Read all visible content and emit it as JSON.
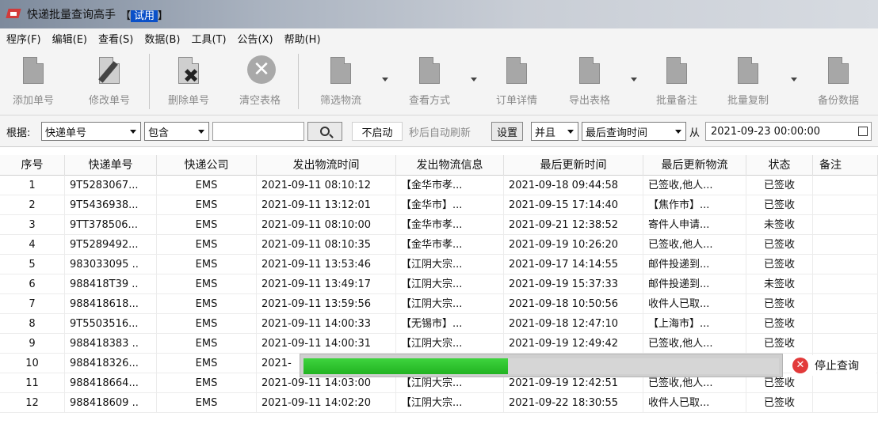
{
  "window": {
    "title": "快递批量查询高手",
    "badge": "试用"
  },
  "menu": [
    "程序(F)",
    "编辑(E)",
    "查看(S)",
    "数据(B)",
    "工具(T)",
    "公告(X)",
    "帮助(H)"
  ],
  "toolbar": {
    "add": "添加单号",
    "edit": "修改单号",
    "delete": "删除单号",
    "clear": "清空表格",
    "filter": "筛选物流",
    "view": "查看方式",
    "detail": "订单详情",
    "export": "导出表格",
    "batch_note": "批量备注",
    "batch_copy": "批量复制",
    "backup": "备份数据"
  },
  "filter": {
    "label": "根据:",
    "field": "快递单号",
    "mode": "包含",
    "query": "",
    "auto_state": "不启动",
    "auto_text": "秒后自动刷新",
    "settings": "设置",
    "logic": "并且",
    "time_field": "最后查询时间",
    "from_label": "从",
    "from_value": "2021-09-23 00:00:00"
  },
  "columns": [
    "序号",
    "快递单号",
    "快递公司",
    "发出物流时间",
    "发出物流信息",
    "最后更新时间",
    "最后更新物流",
    "状态",
    "备注"
  ],
  "rows": [
    [
      "1",
      "9T5283067...",
      "EMS",
      "2021-09-11 08:10:12",
      "【金华市孝...",
      "2021-09-18 09:44:58",
      "已签收,他人...",
      "已签收",
      ""
    ],
    [
      "2",
      "9T5436938...",
      "EMS",
      "2021-09-11 13:12:01",
      "【金华市】...",
      "2021-09-15 17:14:40",
      "【焦作市】...",
      "已签收",
      ""
    ],
    [
      "3",
      "9TT378506...",
      "EMS",
      "2021-09-11 08:10:00",
      "【金华市孝...",
      "2021-09-21 12:38:52",
      "寄件人申请...",
      "未签收",
      ""
    ],
    [
      "4",
      "9T5289492...",
      "EMS",
      "2021-09-11 08:10:35",
      "【金华市孝...",
      "2021-09-19 10:26:20",
      "已签收,他人...",
      "已签收",
      ""
    ],
    [
      "5",
      "983033095 ..",
      "EMS",
      "2021-09-11 13:53:46",
      "【江阴大宗...",
      "2021-09-17 14:14:55",
      "邮件投递到...",
      "已签收",
      ""
    ],
    [
      "6",
      "988418T39 ..",
      "EMS",
      "2021-09-11 13:49:17",
      "【江阴大宗...",
      "2021-09-19 15:37:33",
      "邮件投递到...",
      "未签收",
      ""
    ],
    [
      "7",
      "988418618...",
      "EMS",
      "2021-09-11 13:59:56",
      "【江阴大宗...",
      "2021-09-18 10:50:56",
      "收件人已取...",
      "已签收",
      ""
    ],
    [
      "8",
      "9T5503516...",
      "EMS",
      "2021-09-11 14:00:33",
      "【无锡市】...",
      "2021-09-18 12:47:10",
      "【上海市】...",
      "已签收",
      ""
    ],
    [
      "9",
      "988418383 ..",
      "EMS",
      "2021-09-11 14:00:31",
      "【江阴大宗...",
      "2021-09-19 12:49:42",
      "已签收,他人...",
      "已签收",
      ""
    ],
    [
      "10",
      "988418326...",
      "EMS",
      "2021-",
      "",
      "",
      "",
      "",
      ""
    ],
    [
      "11",
      "988418664...",
      "EMS",
      "2021-09-11 14:03:00",
      "【江阴大宗...",
      "2021-09-19 12:42:51",
      "已签收,他人...",
      "已签收",
      ""
    ],
    [
      "12",
      "988418609 ..",
      "EMS",
      "2021-09-11 14:02:20",
      "【江阴大宗...",
      "2021-09-22 18:30:55",
      "收件人已取...",
      "已签收",
      ""
    ]
  ],
  "progress": {
    "fraction": 0.43,
    "stop_label": "停止查询"
  },
  "colors": {
    "progress": "#22b322",
    "stop": "#e23a3a"
  }
}
